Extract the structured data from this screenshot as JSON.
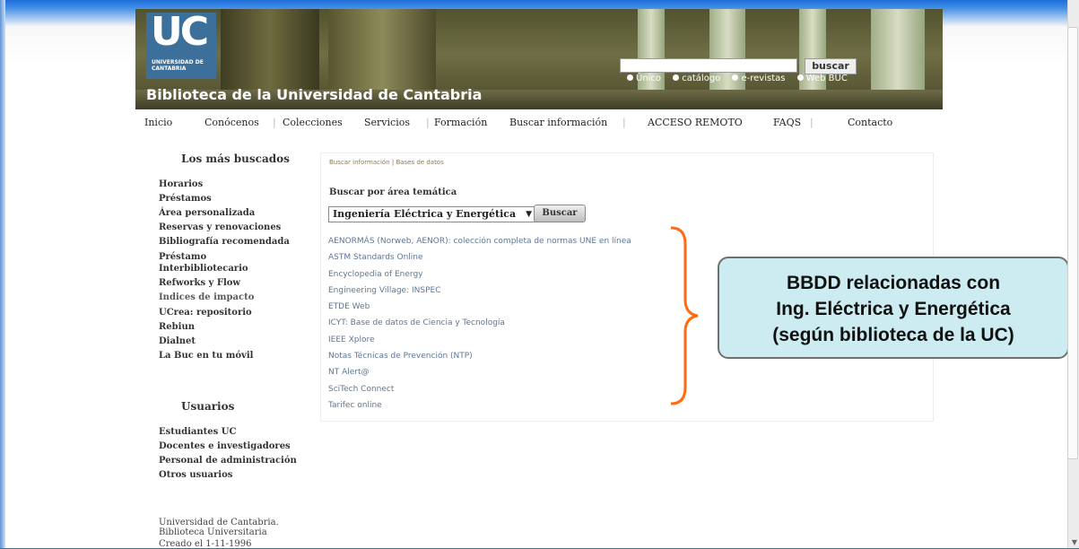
{
  "banner": {
    "logo_text": "UC",
    "logo_subtext": "UNIVERSIDAD DE CANTABRIA",
    "title": "Biblioteca de la Universidad de Cantabria",
    "search_button": "buscar",
    "radios": [
      "Único",
      "catálogo",
      "e-revistas",
      "Web BUC"
    ]
  },
  "topnav": {
    "items": [
      "Inicio",
      "Conócenos",
      "Colecciones",
      "Servicios",
      "Formación",
      "Buscar información",
      "ACCESO REMOTO",
      "FAQS",
      "Contacto"
    ]
  },
  "sidebar": {
    "heading": "Los más buscados",
    "links": [
      "Horarios",
      "Préstamos",
      "Área personalizada",
      "Reservas y renovaciones",
      "Bibliografía recomendada",
      "Préstamo",
      "Interbibliotecario",
      "Refworks y Flow",
      "Indices de impacto",
      "UCrea: repositorio",
      "Rebiun",
      "Dialnet",
      "La Buc en tu móvil"
    ],
    "users_heading": "Usuarios",
    "users_links": [
      "Estudiantes UC",
      "Docentes e investigadores",
      "Personal de administración",
      "Otros usuarios"
    ],
    "footer": [
      "Universidad de Cantabria.",
      "Biblioteca Universitaria",
      "Creado el 1-11-1996"
    ]
  },
  "content": {
    "breadcrumb": "Buscar información | Bases de datos",
    "heading": "Buscar por área temática",
    "select_value": "Ingeniería Eléctrica y Energética",
    "buscar_button": "Buscar",
    "databases": [
      "AENORMÁS (Norweb, AENOR): colección completa de normas UNE en línea",
      "ASTM Standards Online",
      "Encyclopedia of Energy",
      "Engineering Village: INSPEC",
      "ETDE Web",
      "ICYT: Base de datos de Ciencia y Tecnología",
      "IEEE Xplore",
      "Notas Técnicas de Prevención (NTP)",
      "NT Alert@",
      "SciTech Connect",
      "Tarifec online"
    ]
  },
  "callout": {
    "lines": [
      "BBDD relacionadas con",
      "Ing. Eléctrica y Energética",
      "(según biblioteca de la UC)"
    ]
  },
  "colors": {
    "brace": "#ff6a13",
    "callout_bg": "#ccecf1",
    "link": "#5f7693"
  }
}
